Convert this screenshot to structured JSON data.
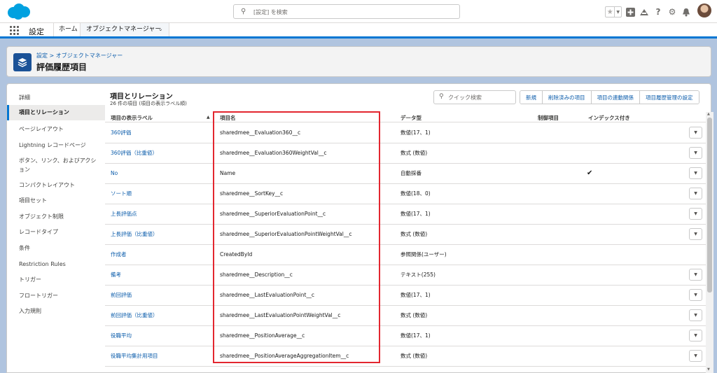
{
  "header": {
    "search_placeholder": "[設定] を検索",
    "icons": [
      "favorites-star-icon",
      "add-icon",
      "trailhead-icon",
      "help-icon",
      "setup-gear-icon",
      "notifications-bell-icon",
      "user-avatar"
    ]
  },
  "app_nav": {
    "app_name": "設定",
    "items": [
      {
        "label": "ホーム"
      },
      {
        "label": "オブジェクトマネージャー"
      }
    ]
  },
  "page_header": {
    "breadcrumb": "設定 > オブジェクトマネージャー",
    "title": "評価履歴項目"
  },
  "left_nav": {
    "items": [
      {
        "label": "詳細"
      },
      {
        "label": "項目とリレーション"
      },
      {
        "label": "ページレイアウト"
      },
      {
        "label": "Lightning レコードページ"
      },
      {
        "label": "ボタン、リンク、およびアクション"
      },
      {
        "label": "コンパクトレイアウト"
      },
      {
        "label": "項目セット"
      },
      {
        "label": "オブジェクト制限"
      },
      {
        "label": "レコードタイプ"
      },
      {
        "label": "条件"
      },
      {
        "label": "Restriction Rules"
      },
      {
        "label": "トリガー"
      },
      {
        "label": "フロートリガー"
      },
      {
        "label": "入力規則"
      }
    ]
  },
  "section": {
    "title": "項目とリレーション",
    "subtitle": "26 件の項目 (項目の表示ラベル順)",
    "quick_search_placeholder": "クイック検索",
    "buttons": {
      "new": "新規",
      "deleted": "削除済みの項目",
      "dependencies": "項目の連動関係",
      "history_tracking": "項目履歴管理の設定"
    }
  },
  "table": {
    "columns": {
      "label": "項目の表示ラベル",
      "api": "項目名",
      "type": "データ型",
      "controlling": "制御項目",
      "indexed": "インデックス付き"
    },
    "rows": [
      {
        "label": "360評価",
        "api": "sharedmee__Evaluation360__c",
        "type": "数値(17、1)",
        "indexed": "",
        "has_action": true
      },
      {
        "label": "360評価（比重値）",
        "api": "sharedmee__Evaluation360WeightVal__c",
        "type": "数式 (数値)",
        "indexed": "",
        "has_action": true
      },
      {
        "label": "No",
        "api": "Name",
        "type": "自動採番",
        "indexed": "✔",
        "has_action": true
      },
      {
        "label": "ソート順",
        "api": "sharedmee__SortKey__c",
        "type": "数値(18、0)",
        "indexed": "",
        "has_action": true
      },
      {
        "label": "上長評価点",
        "api": "sharedmee__SuperiorEvaluationPoint__c",
        "type": "数値(17、1)",
        "indexed": "",
        "has_action": true
      },
      {
        "label": "上長評価（比重値）",
        "api": "sharedmee__SuperiorEvaluationPointWeightVal__c",
        "type": "数式 (数値)",
        "indexed": "",
        "has_action": true
      },
      {
        "label": "作成者",
        "api": "CreatedById",
        "type": "参照関係(ユーザー)",
        "indexed": "",
        "has_action": false
      },
      {
        "label": "備考",
        "api": "sharedmee__Description__c",
        "type": "テキスト(255)",
        "indexed": "",
        "has_action": true
      },
      {
        "label": "前回評価",
        "api": "sharedmee__LastEvaluationPoint__c",
        "type": "数値(17、1)",
        "indexed": "",
        "has_action": true
      },
      {
        "label": "前回評価（比重値）",
        "api": "sharedmee__LastEvaluationPointWeightVal__c",
        "type": "数式 (数値)",
        "indexed": "",
        "has_action": true
      },
      {
        "label": "役職平均",
        "api": "sharedmee__PositionAverage__c",
        "type": "数値(17、1)",
        "indexed": "",
        "has_action": true
      },
      {
        "label": "役職平均集計用項目",
        "api": "sharedmee__PositionAverageAggregationItem__c",
        "type": "数式 (数値)",
        "indexed": "",
        "has_action": true
      }
    ]
  },
  "colors": {
    "brand_blue": "#0176d3",
    "link_blue": "#0b5cab",
    "highlight_red": "#e3262f",
    "background": "#b0c4df"
  }
}
